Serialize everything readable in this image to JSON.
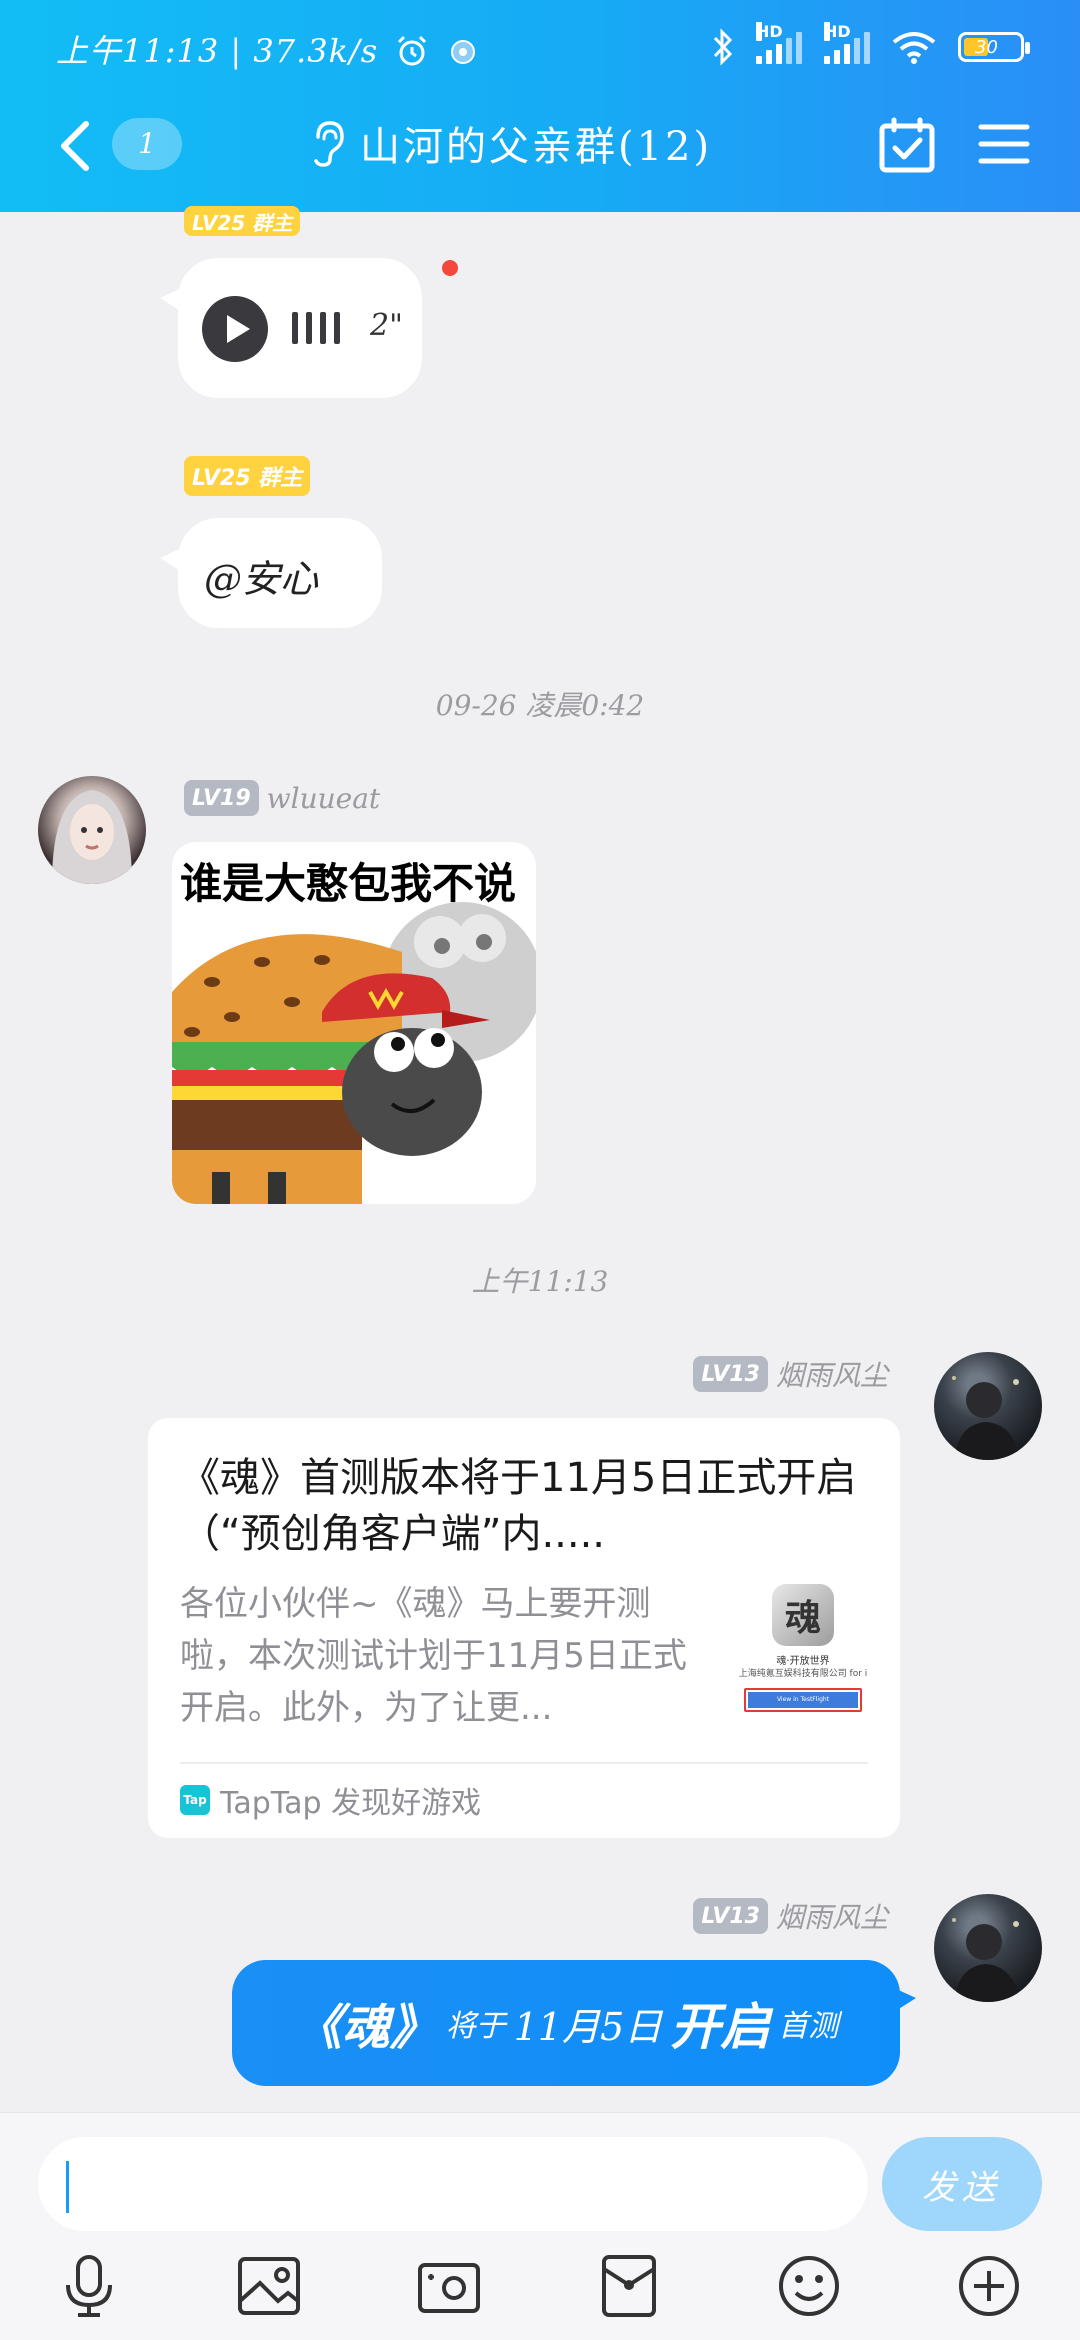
{
  "status_bar": {
    "time": "上午11:13",
    "speed": "37.3k/s",
    "hd1": "HD",
    "hd2": "HD",
    "battery": "30"
  },
  "nav": {
    "unread_count": "1",
    "title": "山河的父亲群(12)"
  },
  "messages": {
    "m1": {
      "level": "LV25 群主",
      "voice_duration": "2\""
    },
    "m2": {
      "level": "LV25 群主",
      "text": "@安心"
    },
    "divider1": "09-26 凌晨0:42",
    "m3": {
      "level": "LV19",
      "name": "wluueat",
      "sticker_text": "谁是大憨包我不说"
    },
    "divider2": "上午11:13",
    "m4": {
      "level": "LV13",
      "name": "烟雨风尘",
      "card_title": "《魂》首测版本将于11月5日正式开启（“预创角客户端”内.....",
      "card_desc": "各位小伙伴~《魂》马上要开测啦，本次测试计划于11月5日正式开启。此外，为了让更...",
      "thumb_line1": "魂·开放世界",
      "thumb_line2": "上海纯氪互娱科技有限公司 for i",
      "thumb_btn": "View in TestFlight",
      "source": "TapTap 发现好游戏",
      "source_logo": "Tap"
    },
    "m5": {
      "level": "LV13",
      "name": "烟雨风尘",
      "parts": [
        "《魂》",
        "将于",
        "11月5日",
        "开启",
        "首测"
      ]
    }
  },
  "input": {
    "send_label": "发送"
  },
  "colors": {
    "header_start": "#12bdf5",
    "header_end": "#2a8ef7",
    "bubble_blue": "#1a8ff5",
    "level_gold": "#ffd23f",
    "level_gray": "#b5b9c4",
    "send_button": "#9fd6fb"
  },
  "icons": {
    "toolbar": [
      "microphone-icon",
      "image-icon",
      "camera-icon",
      "red-packet-icon",
      "emoji-icon",
      "plus-icon"
    ]
  }
}
